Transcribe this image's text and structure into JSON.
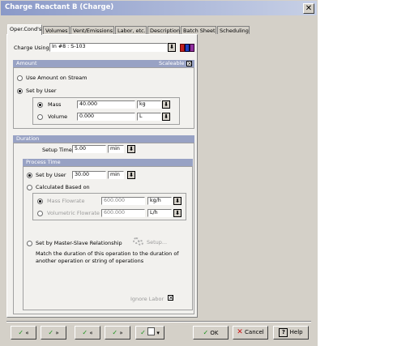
{
  "window": {
    "title": "Charge Reactant B (Charge)",
    "close_glyph": "✕"
  },
  "tabs": [
    {
      "label": "Oper.Cond's"
    },
    {
      "label": "Volumes"
    },
    {
      "label": "Vent/Emissions"
    },
    {
      "label": "Labor, etc."
    },
    {
      "label": "Description"
    },
    {
      "label": "Batch Sheet"
    },
    {
      "label": "Scheduling"
    }
  ],
  "charge": {
    "label": "Charge Using",
    "value": "In #8 : S-103"
  },
  "amount": {
    "header": "Amount",
    "scaleable_label": "Scaleable",
    "scaleable_checked": "✕",
    "use_stream_label": "Use Amount on Stream",
    "set_by_user_label": "Set by User",
    "mass": {
      "label": "Mass",
      "value": "40.000",
      "unit": "kg"
    },
    "volume": {
      "label": "Volume",
      "value": "0.000",
      "unit": "L"
    }
  },
  "duration": {
    "header": "Duration",
    "setup_label": "Setup Time",
    "setup_value": "5.00",
    "setup_unit": "min",
    "process_time": {
      "header": "Process Time",
      "set_by_user_label": "Set by User",
      "set_by_user_value": "30.00",
      "set_by_user_unit": "min",
      "calculated_label": "Calculated Based on",
      "mass_flowrate": {
        "label": "Mass Flowrate",
        "value": "600.000",
        "unit": "kg/h"
      },
      "vol_flowrate": {
        "label": "Volumetric Flowrate",
        "value": "600.000",
        "unit": "L/h"
      },
      "master_slave_label": "Set by Master-Slave Relationship",
      "setup_button": "Setup...",
      "match_text_1": "Match the duration of this operation to the duration of",
      "match_text_2": "another operation or string of operations",
      "ignore_label": "Ignore Labor",
      "ignore_checked": "✕"
    }
  },
  "dropdown_glyph": "⬇",
  "footer": {
    "buttons": [
      {
        "icon": "✓",
        "label": "«"
      },
      {
        "icon": "✓",
        "label": "»"
      },
      {
        "icon": "✓",
        "label": "«"
      },
      {
        "icon": "✓",
        "label": "»"
      },
      {
        "icon": "✓",
        "label": "▾"
      }
    ],
    "ok": {
      "icon": "✓",
      "label": "OK"
    },
    "cancel": {
      "icon": "✕",
      "label": "Cancel"
    },
    "help": {
      "icon": "?",
      "label": "Help"
    }
  }
}
